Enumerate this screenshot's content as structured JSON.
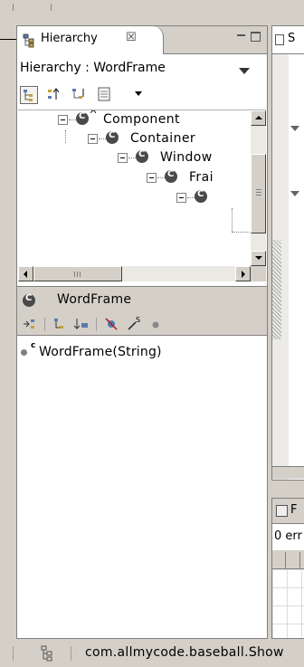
{
  "hierarchy_view": {
    "tab_label": "Hierarchy",
    "tab_close": "☒",
    "title": "Hierarchy : WordFrame",
    "toolbar_icons": [
      "type-hierarchy-icon",
      "supertype-hierarchy-icon",
      "subtype-hierarchy-icon",
      "history-list-icon"
    ],
    "tree": [
      {
        "label": "Component",
        "superscript": "A"
      },
      {
        "label": "Container",
        "superscript": ""
      },
      {
        "label": "Window",
        "superscript": ""
      },
      {
        "label": "Frai",
        "superscript": ""
      },
      {
        "label": "",
        "superscript": ""
      }
    ],
    "member_header": "WordFrame",
    "member_toolbar_icons": [
      "show-all-inherited-icon",
      "lock-view-icon",
      "sort-by-type-icon",
      "hide-fields-icon",
      "hide-static-icon",
      "hide-non-public-icon"
    ],
    "members": [
      {
        "label": "WordFrame(String)",
        "modifier": "c"
      }
    ]
  },
  "editor": {
    "tab_label": "S"
  },
  "problems": {
    "tab_label": "F",
    "summary": "0 err"
  },
  "status_bar": {
    "text": "com.allmycode.baseball.Show"
  },
  "colors": {
    "chrome": "#d4d0c8",
    "panel": "#ffffff",
    "border": "#808080",
    "class_icon": "#4a4a4a"
  }
}
